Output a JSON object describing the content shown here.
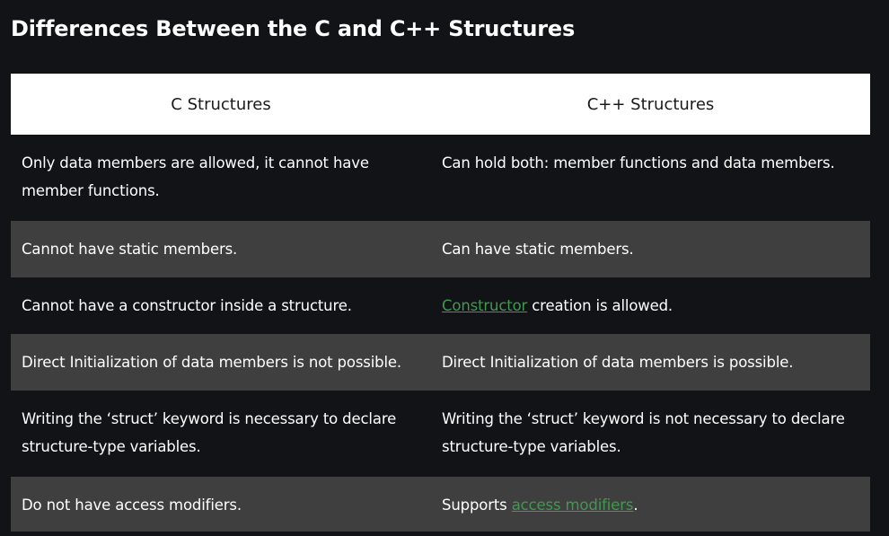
{
  "page": {
    "title": "Differences Between the C and C++ Structures"
  },
  "table": {
    "headers": [
      "C Structures",
      "C++ Structures"
    ],
    "rows": [
      {
        "c": "Only data members are allowed, it cannot have member functions.",
        "cpp": "Can hold both: member functions and data members."
      },
      {
        "c": "Cannot have static members.",
        "cpp": "Can have static members."
      },
      {
        "c": "Cannot have a constructor inside a structure.",
        "cpp_link": "Constructor",
        "cpp_after": " creation is allowed."
      },
      {
        "c": "Direct Initialization of data members is not possible.",
        "cpp": "Direct Initialization of data members is possible."
      },
      {
        "c": "Writing the ‘struct’ keyword is necessary to declare structure-type variables.",
        "cpp": "Writing the ‘struct’ keyword is not necessary to declare structure-type variables."
      },
      {
        "c": "Do not have access modifiers.",
        "cpp_before": "Supports ",
        "cpp_link": "access modifiers",
        "cpp_after": "."
      }
    ]
  },
  "colors": {
    "background": "#121316",
    "row_alt": "#3f3f3f",
    "header_bg": "#ffffff",
    "link": "#3f9a4e"
  }
}
